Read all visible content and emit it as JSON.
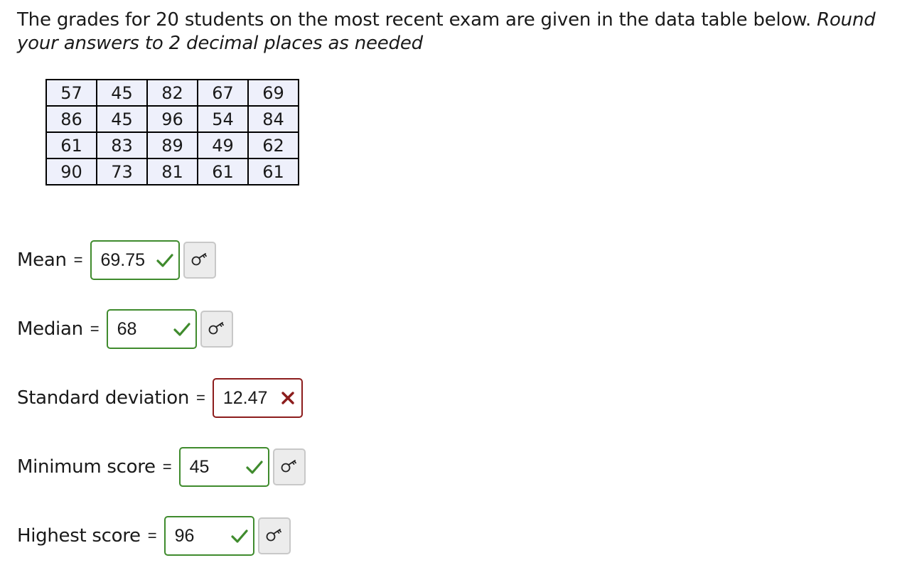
{
  "prompt": {
    "text": "The grades for 20 students on the most recent exam are given in the data table below. ",
    "instruction": "Round your answers to 2 decimal places as needed"
  },
  "grades_table": {
    "rows": [
      [
        "57",
        "45",
        "82",
        "67",
        "69"
      ],
      [
        "86",
        "45",
        "96",
        "54",
        "84"
      ],
      [
        "61",
        "83",
        "89",
        "49",
        "62"
      ],
      [
        "90",
        "73",
        "81",
        "61",
        "61"
      ]
    ]
  },
  "answers": [
    {
      "label": "Mean",
      "equals": "=",
      "value": "69.75",
      "status": "correct",
      "hint": true
    },
    {
      "label": "Median",
      "equals": "=",
      "value": "68",
      "status": "correct",
      "hint": true
    },
    {
      "label": "Standard deviation",
      "equals": "=",
      "value": "12.47",
      "status": "incorrect",
      "hint": false
    },
    {
      "label": "Minimum score",
      "equals": "=",
      "value": "45",
      "status": "correct",
      "hint": true
    },
    {
      "label": "Highest score",
      "equals": "=",
      "value": "96",
      "status": "correct",
      "hint": true
    }
  ],
  "colors": {
    "correct": "#3f8b2d",
    "incorrect": "#8c1c1c",
    "table_cell_bg": "#eef0fb",
    "hint_bg": "#ececec"
  },
  "icons": {
    "correct": "check-icon",
    "incorrect": "x-icon",
    "hint": "key-icon"
  }
}
